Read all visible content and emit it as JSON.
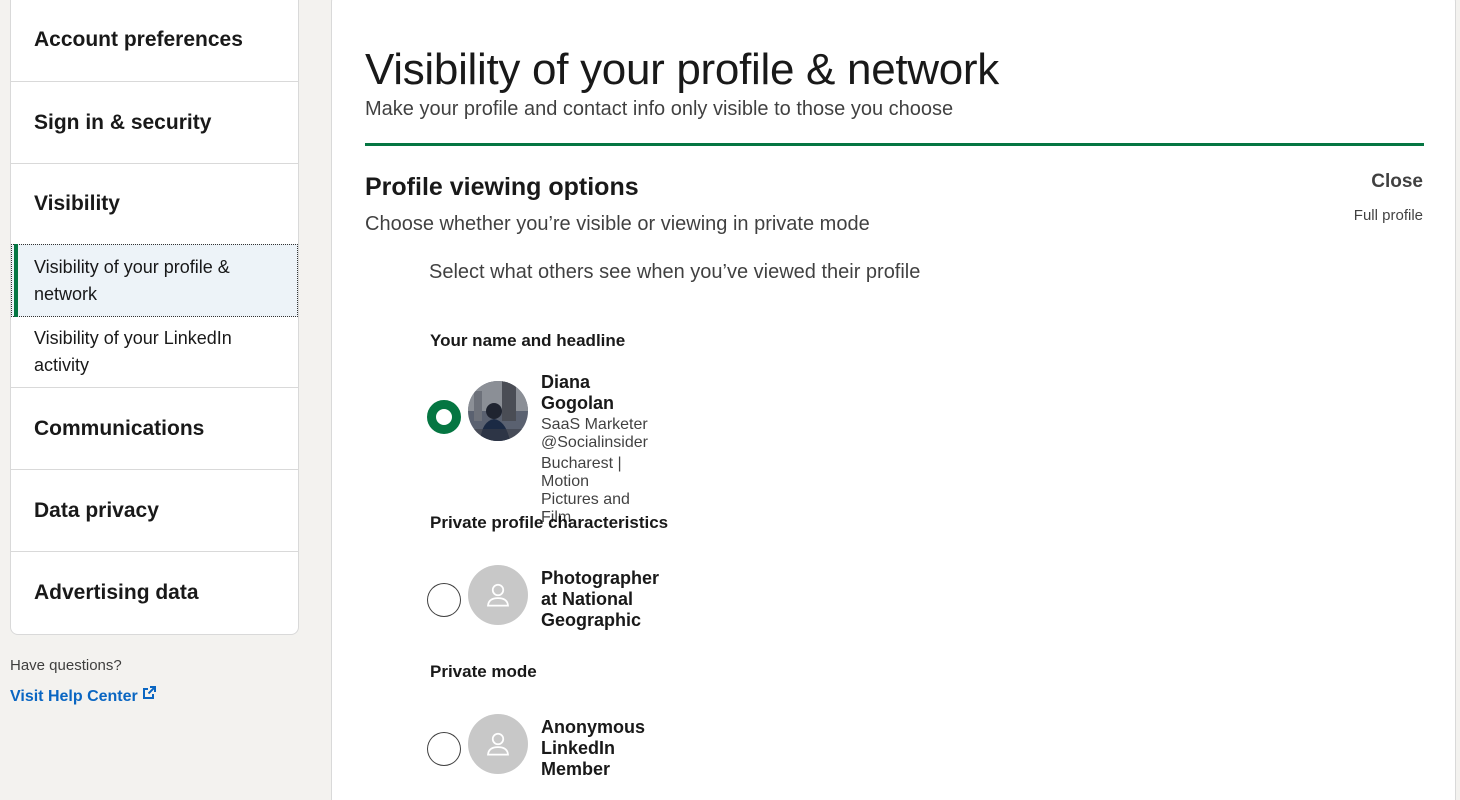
{
  "sidebar": {
    "sections": [
      {
        "label": "Account preferences"
      },
      {
        "label": "Sign in & security"
      },
      {
        "label": "Visibility"
      },
      {
        "label": "Communications"
      },
      {
        "label": "Data privacy"
      },
      {
        "label": "Advertising data"
      }
    ],
    "visibility_items": [
      {
        "label": "Visibility of your profile & network",
        "active": true
      },
      {
        "label": "Visibility of your LinkedIn activity",
        "active": false
      }
    ],
    "help_question": "Have questions?",
    "help_link": "Visit Help Center"
  },
  "main": {
    "title": "Visibility of your profile & network",
    "subtitle": "Make your profile and contact info only visible to those you choose",
    "section_title": "Profile viewing options",
    "section_desc": "Choose whether you’re visible or viewing in private mode",
    "close_label": "Close",
    "current_value": "Full profile",
    "instruction": "Select what others see when you’ve viewed their profile",
    "options": [
      {
        "heading": "Your name and headline",
        "name": "Diana Gogolan",
        "line1": "SaaS Marketer @Socialinsider",
        "line2": "Bucharest | Motion Pictures and Film",
        "selected": true
      },
      {
        "heading": "Private profile characteristics",
        "name": "Photographer at National Geographic",
        "selected": false
      },
      {
        "heading": "Private mode",
        "name": "Anonymous LinkedIn Member",
        "selected": false
      }
    ]
  },
  "colors": {
    "accent_green": "#057642",
    "link_blue": "#0a66c2",
    "active_bg": "#edf3f8",
    "page_bg": "#f3f2ef"
  },
  "icons": {
    "external": "external-link-icon",
    "ghost": "ghost-person-icon"
  }
}
